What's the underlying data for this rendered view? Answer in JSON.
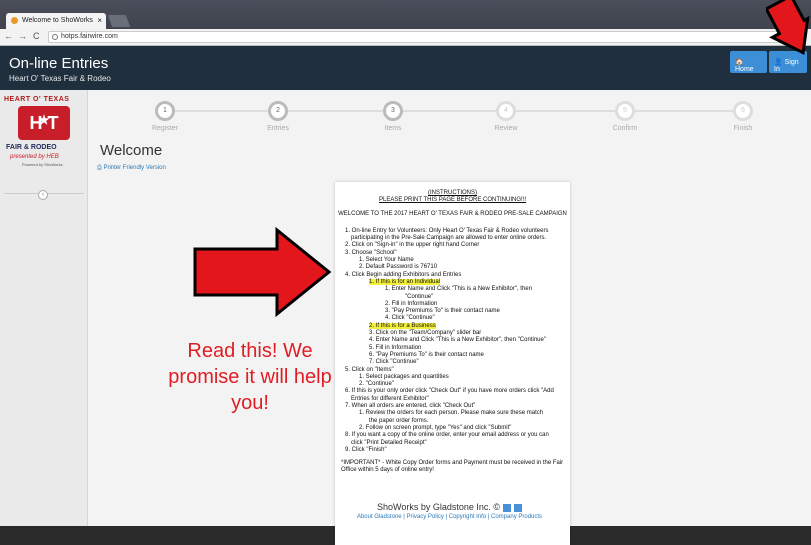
{
  "browser": {
    "tab_title": "Welcome to ShoWorks",
    "url": "hotps.fairwire.com",
    "back": "←",
    "forward": "→",
    "reload": "C"
  },
  "header": {
    "title": "On-line Entries",
    "subtitle": "Heart O' Texas Fair & Rodeo",
    "home": "🏠 Home",
    "signin": "👤 Sign In"
  },
  "logo": {
    "top": "HEART O' TEXAS",
    "mid": "H  T",
    "fair": "FAIR & RODEO",
    "presented": "presented by HEB",
    "powered": "Powered by ShoWorks"
  },
  "steps": [
    {
      "num": "1",
      "label": "Register"
    },
    {
      "num": "2",
      "label": "Entries"
    },
    {
      "num": "3",
      "label": "Items"
    },
    {
      "num": "4",
      "label": "Review"
    },
    {
      "num": "5",
      "label": "Confirm"
    },
    {
      "num": "6",
      "label": "Finish"
    }
  ],
  "page": {
    "welcome": "Welcome",
    "printer": "Printer Friendly Version"
  },
  "overlay": {
    "text": "Read this! We promise it will help you!"
  },
  "doc": {
    "title": "(INSTRUCTIONS)",
    "print": "PLEASE PRINT THIS PAGE BEFORE CONTINUING!!!",
    "welcome": "WELCOME TO THE 2017 HEART O' TEXAS FAIR & RODEO PRE-SALE CAMPAIGN",
    "l1a": "1. On-line Entry for Volunteers: Only Heart O' Texas Fair & Rodeo volunteers",
    "l1b": "participating in the Pre-Sale Campaign are allowed to enter online orders.",
    "l2": "2. Click on \"Sign-in\" in the upper right hand Corner",
    "l3": "3. Choose \"School\"",
    "l3a": "1. Select Your Name",
    "l3b": "2. Default Password is 76710",
    "l4": "4. Click Begin adding Exhibitors and Entries",
    "l4a": "1. If this is for an Individual",
    "l4a1": "1. Enter Name and Click \"This is a New Exhibitor\", then",
    "l4a1b": "\"Continue\"",
    "l4a2": "2. Fill in Information",
    "l4a3": "3. \"Pay Premiums To\" is their contact name",
    "l4a4": "4. Click \"Continue\"",
    "l4b": "2. If this is for a Business",
    "l4b3": "3. Click on the \"Team/Company\" slider bar",
    "l4b4": "4. Enter Name and Click \"This is a New Exhibitor\", then \"Continue\"",
    "l4b5": "5. Fill in Information",
    "l4b6": "6. \"Pay Premiums To\" is their contact name",
    "l4b7": "7. Click \"Continue\"",
    "l5": "5. Click on \"Items\"",
    "l5a": "1. Select packages and quantities",
    "l5b": "2. \"Continue\"",
    "l6a": "6. If this is your only order click \"Check Out\" if you have more orders click \"Add",
    "l6b": "Entries for different Exhibitor\"",
    "l7": "7. When all orders are entered, click \"Check Out\"",
    "l7a": "1. Review the orders for each person. Please make sure these match",
    "l7ab": "the paper order forms.",
    "l7b": "2. Follow on screen prompt, type \"Yes\" and click \"Submit\"",
    "l8a": "8. If you want a copy of the online order, enter your email address or you can",
    "l8b": "click \"Print Detailed Receipt\"",
    "l9": "9. Click \"Finish\"",
    "imp1": "*IMPORTANT* - White Copy Order forms and Payment must be received in the Fair",
    "imp2": "Office within 5 days of online entry!"
  },
  "footer": {
    "brand": "ShoWorks by Gladstone Inc. ©",
    "links": "About Gladstone | Privacy Policy | Copyright Info | Company Products"
  }
}
